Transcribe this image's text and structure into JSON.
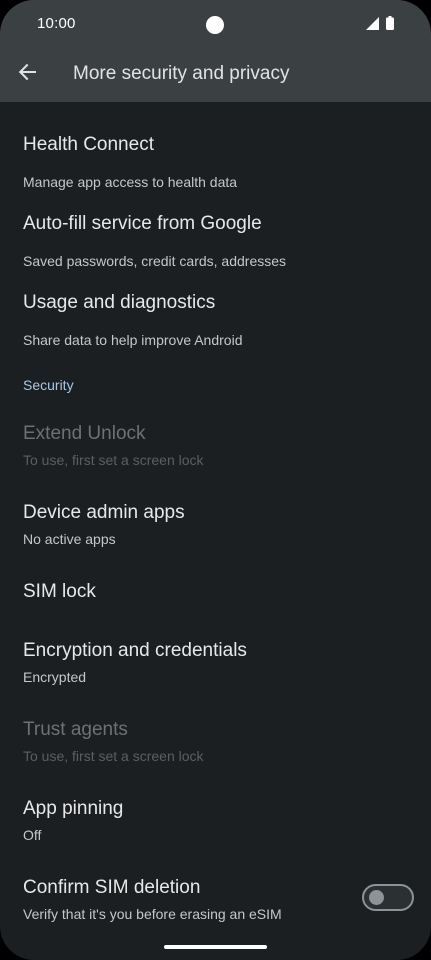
{
  "status_bar": {
    "time": "10:00",
    "icons": [
      "signal-icon",
      "battery-icon"
    ]
  },
  "app_bar": {
    "back_icon": "arrow-back-icon",
    "title": "More security and privacy"
  },
  "items": [
    {
      "title": "Health Connect",
      "subtitle": "Manage app access to health data",
      "enabled": true
    },
    {
      "title": "Auto-fill service from Google",
      "subtitle": "Saved passwords, credit cards, addresses",
      "enabled": true
    },
    {
      "title": "Usage and diagnostics",
      "subtitle": "Share data to help improve Android",
      "enabled": true
    }
  ],
  "security_section": {
    "header": "Security",
    "items": [
      {
        "title": "Extend Unlock",
        "subtitle": "To use, first set a screen lock",
        "enabled": false
      },
      {
        "title": "Device admin apps",
        "subtitle": "No active apps",
        "enabled": true
      },
      {
        "title": "SIM lock",
        "subtitle": "",
        "enabled": true
      },
      {
        "title": "Encryption and credentials",
        "subtitle": "Encrypted",
        "enabled": true
      },
      {
        "title": "Trust agents",
        "subtitle": "To use, first set a screen lock",
        "enabled": false
      },
      {
        "title": "App pinning",
        "subtitle": "Off",
        "enabled": true
      },
      {
        "title": "Confirm SIM deletion",
        "subtitle": "Verify that it's you before erasing an eSIM",
        "enabled": true,
        "toggle": false
      }
    ]
  },
  "colors": {
    "background": "#1b1f22",
    "app_bar": "#3b4043",
    "section_header": "#a8c7e6",
    "text_primary": "#e8e8e8",
    "text_secondary": "#c5c7c8",
    "text_disabled": "#6d7174"
  }
}
